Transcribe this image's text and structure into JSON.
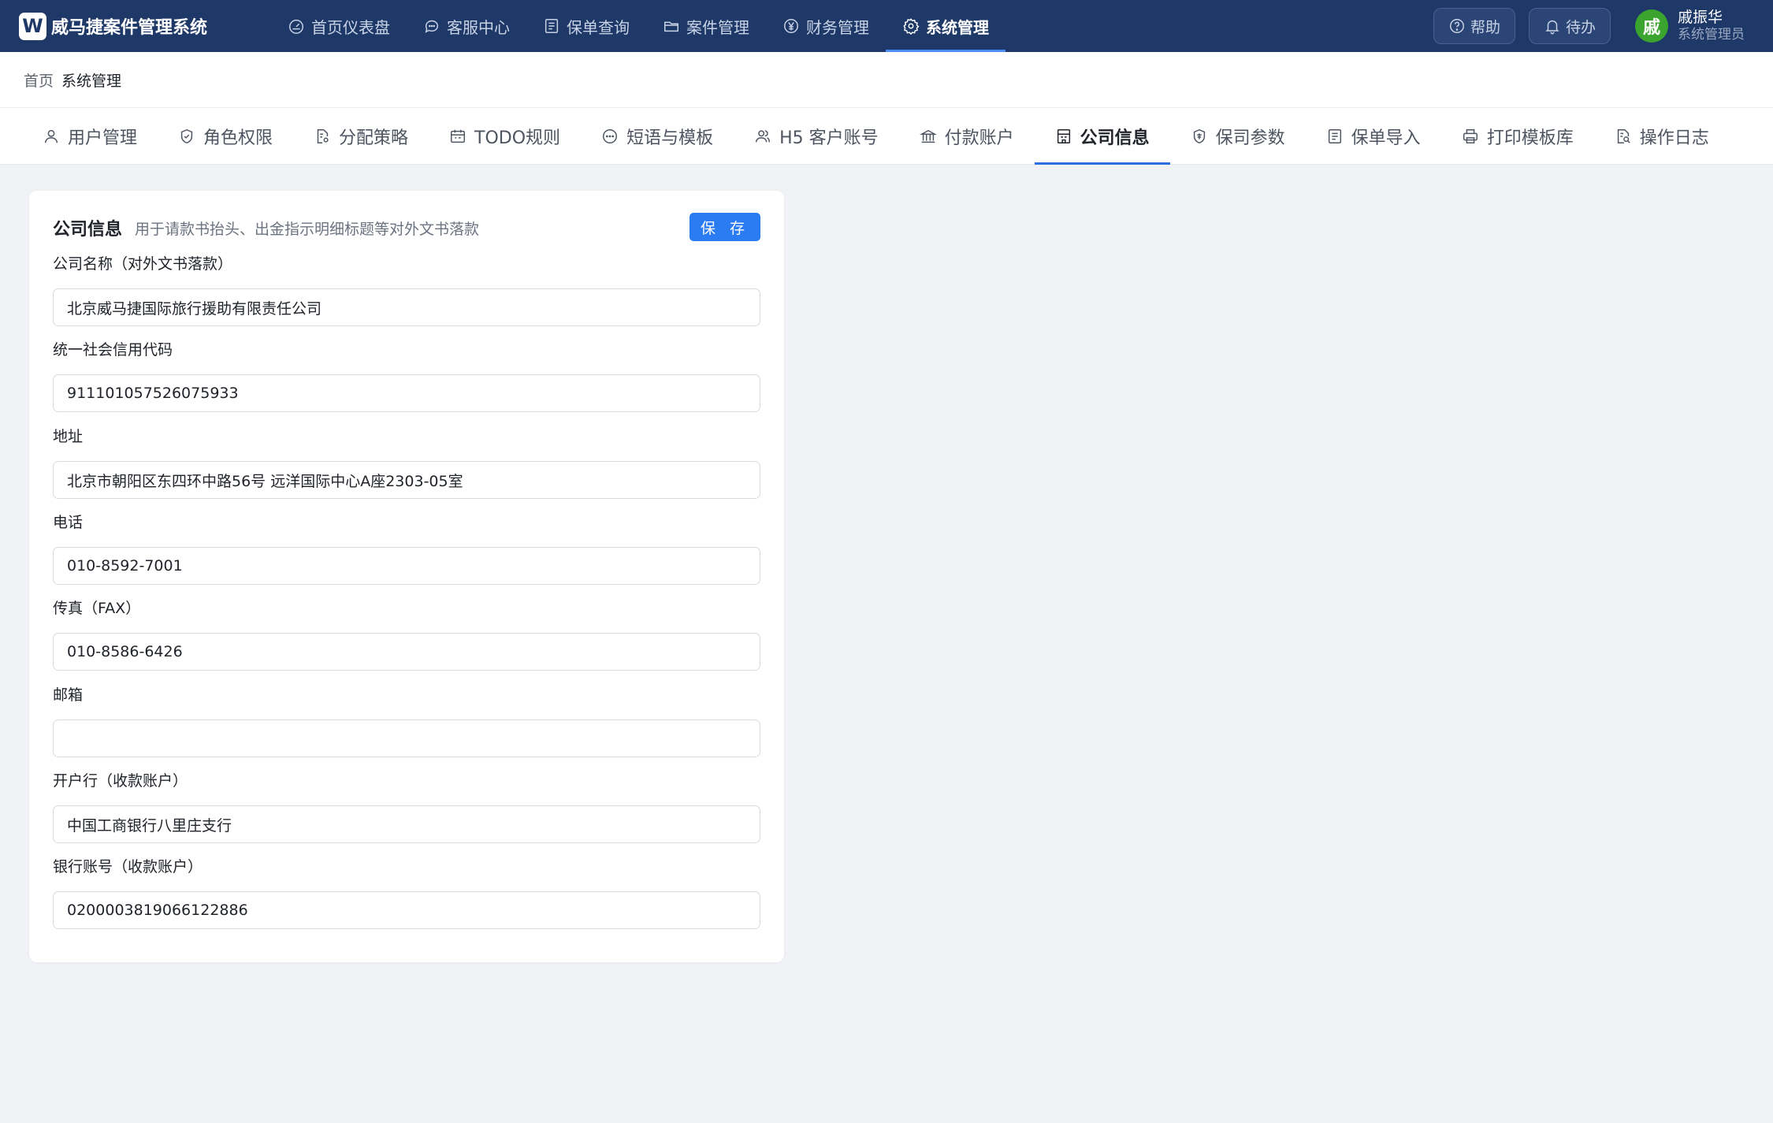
{
  "app": {
    "logo_letter": "W",
    "title": "威马捷案件管理系统"
  },
  "nav": {
    "items": [
      {
        "label": "首页仪表盘",
        "icon": "dashboard-icon"
      },
      {
        "label": "客服中心",
        "icon": "chat-icon"
      },
      {
        "label": "保单查询",
        "icon": "list-icon"
      },
      {
        "label": "案件管理",
        "icon": "folder-icon"
      },
      {
        "label": "财务管理",
        "icon": "yuan-icon"
      },
      {
        "label": "系统管理",
        "icon": "gear-icon",
        "active": true
      }
    ]
  },
  "header_actions": {
    "help": "帮助",
    "todo": "待办"
  },
  "user": {
    "avatar_char": "戚",
    "name": "戚振华",
    "role": "系统管理员"
  },
  "breadcrumb": {
    "home": "首页",
    "current": "系统管理"
  },
  "tabs": [
    {
      "label": "用户管理",
      "icon": "user-icon"
    },
    {
      "label": "角色权限",
      "icon": "shield-check-icon"
    },
    {
      "label": "分配策略",
      "icon": "file-settings-icon"
    },
    {
      "label": "TODO规则",
      "icon": "calendar-icon"
    },
    {
      "label": "短语与模板",
      "icon": "message-dots-icon"
    },
    {
      "label": "H5 客户账号",
      "icon": "user-group-icon"
    },
    {
      "label": "付款账户",
      "icon": "bank-icon"
    },
    {
      "label": "公司信息",
      "icon": "building-icon",
      "active": true
    },
    {
      "label": "保司参数",
      "icon": "shield-badge-icon"
    },
    {
      "label": "保单导入",
      "icon": "list-icon"
    },
    {
      "label": "打印模板库",
      "icon": "printer-icon"
    },
    {
      "label": "操作日志",
      "icon": "file-search-icon"
    }
  ],
  "form": {
    "title": "公司信息",
    "description": "用于请款书抬头、出金指示明细标题等对外文书落款",
    "save_label": "保 存",
    "fields": [
      {
        "label": "公司名称（对外文书落款）",
        "value": "北京威马捷国际旅行援助有限责任公司"
      },
      {
        "label": "统一社会信用代码",
        "value": "911101057526075933"
      },
      {
        "label": "地址",
        "value": "北京市朝阳区东四环中路56号 远洋国际中心A座2303-05室"
      },
      {
        "label": "电话",
        "value": "010-8592-7001"
      },
      {
        "label": "传真（FAX）",
        "value": "010-8586-6426"
      },
      {
        "label": "邮箱",
        "value": ""
      },
      {
        "label": "开户行（收款账户）",
        "value": "中国工商银行八里庄支行"
      },
      {
        "label": "银行账号（收款账户）",
        "value": "0200003819066122886"
      }
    ]
  }
}
